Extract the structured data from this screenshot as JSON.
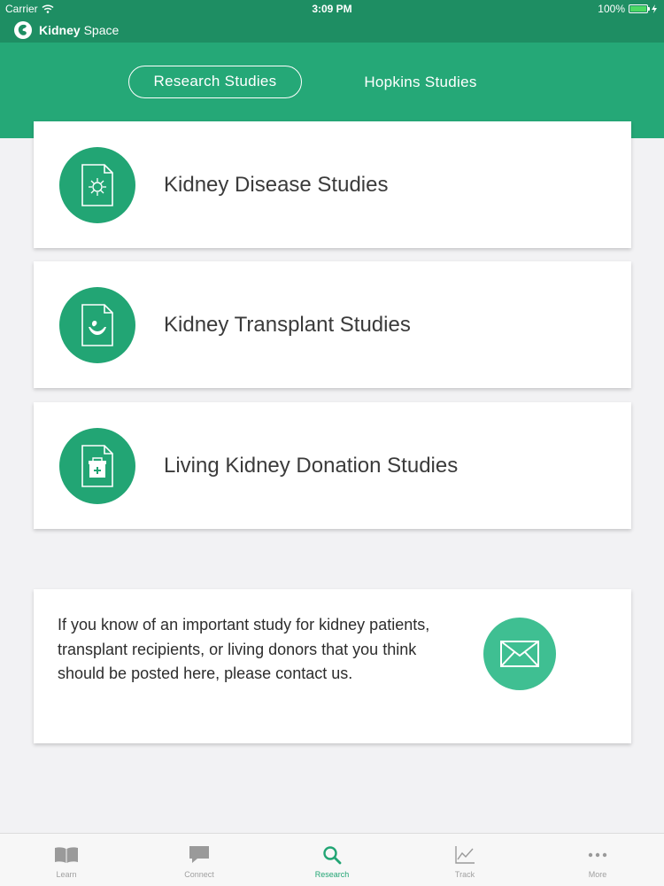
{
  "status_bar": {
    "carrier": "Carrier",
    "time": "3:09 PM",
    "battery": "100%"
  },
  "app": {
    "title_bold": "Kidney",
    "title_rest": " Space"
  },
  "segmented_tabs": [
    {
      "label": "Research Studies",
      "selected": true
    },
    {
      "label": "Hopkins Studies",
      "selected": false
    }
  ],
  "studies": [
    {
      "label": "Kidney Disease Studies",
      "icon": "document-virus-icon"
    },
    {
      "label": "Kidney Transplant Studies",
      "icon": "document-hands-kidney-icon"
    },
    {
      "label": "Living Kidney Donation Studies",
      "icon": "document-cooler-icon"
    }
  ],
  "contact": {
    "text": "If you know of an important study for kidney patients, transplant recipients, or living donors that you think should be posted here, please contact us.",
    "icon": "envelope-icon"
  },
  "tab_bar": [
    {
      "label": "Learn",
      "icon": "book-icon",
      "active": false
    },
    {
      "label": "Connect",
      "icon": "chat-bubble-icon",
      "active": false
    },
    {
      "label": "Research",
      "icon": "search-icon",
      "active": true
    },
    {
      "label": "Track",
      "icon": "line-chart-icon",
      "active": false
    },
    {
      "label": "More",
      "icon": "more-dots-icon",
      "active": false
    }
  ],
  "colors": {
    "header_green": "#1e8e63",
    "band_green": "#25a877",
    "accent_green": "#22a574",
    "mail_green": "#3fbf92",
    "background": "#f2f2f4"
  }
}
